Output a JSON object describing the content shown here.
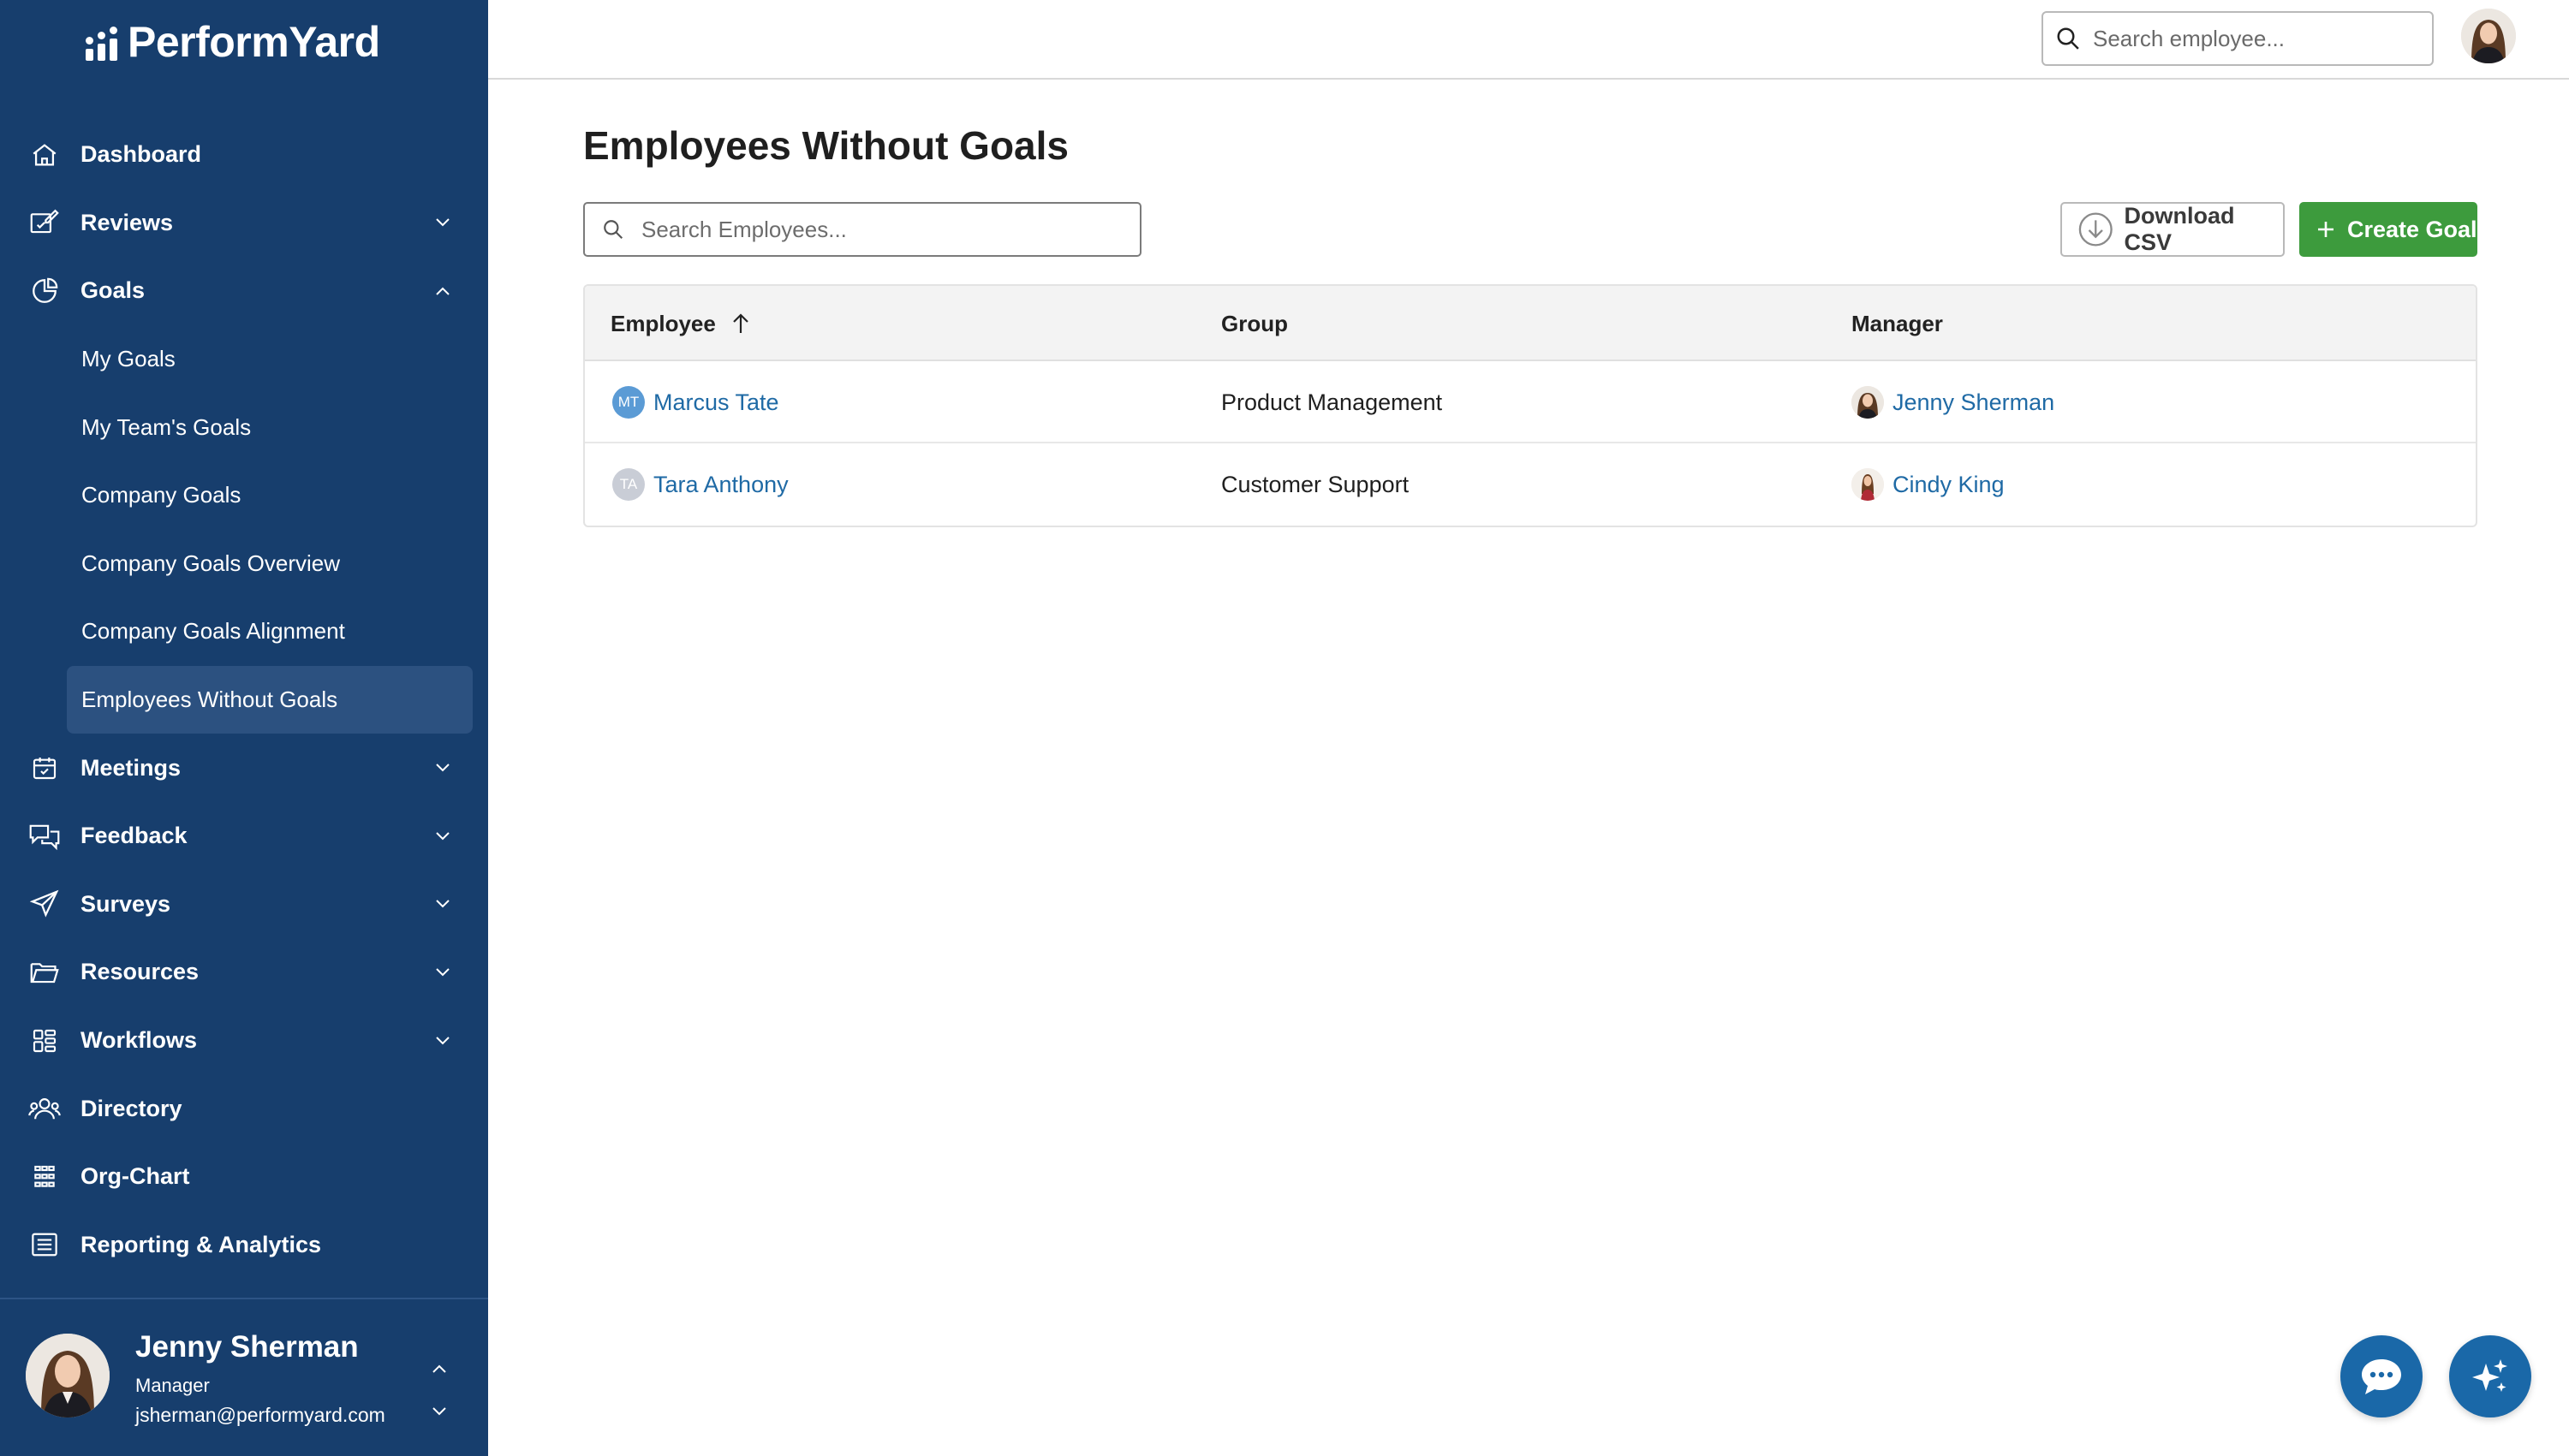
{
  "app": {
    "logo_text": "PerformYard"
  },
  "topbar": {
    "search_placeholder": "Search employee..."
  },
  "sidebar": {
    "items": [
      {
        "label": "Dashboard"
      },
      {
        "label": "Reviews"
      },
      {
        "label": "Goals"
      },
      {
        "label": "Meetings"
      },
      {
        "label": "Feedback"
      },
      {
        "label": "Surveys"
      },
      {
        "label": "Resources"
      },
      {
        "label": "Workflows"
      },
      {
        "label": "Directory"
      },
      {
        "label": "Org-Chart"
      },
      {
        "label": "Reporting & Analytics"
      }
    ],
    "goals_sub": [
      {
        "label": "My Goals"
      },
      {
        "label": "My Team's Goals"
      },
      {
        "label": "Company Goals"
      },
      {
        "label": "Company Goals Overview"
      },
      {
        "label": "Company Goals Alignment"
      },
      {
        "label": "Employees Without Goals"
      }
    ]
  },
  "profile": {
    "name": "Jenny Sherman",
    "role": "Manager",
    "email": "jsherman@performyard.com"
  },
  "main": {
    "title": "Employees Without Goals",
    "search_placeholder": "Search Employees...",
    "download_label": "Download CSV",
    "create_label": "Create Goal"
  },
  "table": {
    "headers": {
      "employee": "Employee",
      "group": "Group",
      "manager": "Manager"
    },
    "rows": [
      {
        "initials": "MT",
        "initials_color": "#5b9bd5",
        "employee": "Marcus Tate",
        "group": "Product Management",
        "manager": "Jenny Sherman"
      },
      {
        "initials": "TA",
        "initials_color": "#c9cdd6",
        "employee": "Tara Anthony",
        "group": "Customer Support",
        "manager": "Cindy King"
      }
    ]
  },
  "colors": {
    "sidebar": "#173e6d",
    "accent_green": "#3d9b3d",
    "link": "#1f6aa5",
    "fab": "#1a68a8"
  }
}
